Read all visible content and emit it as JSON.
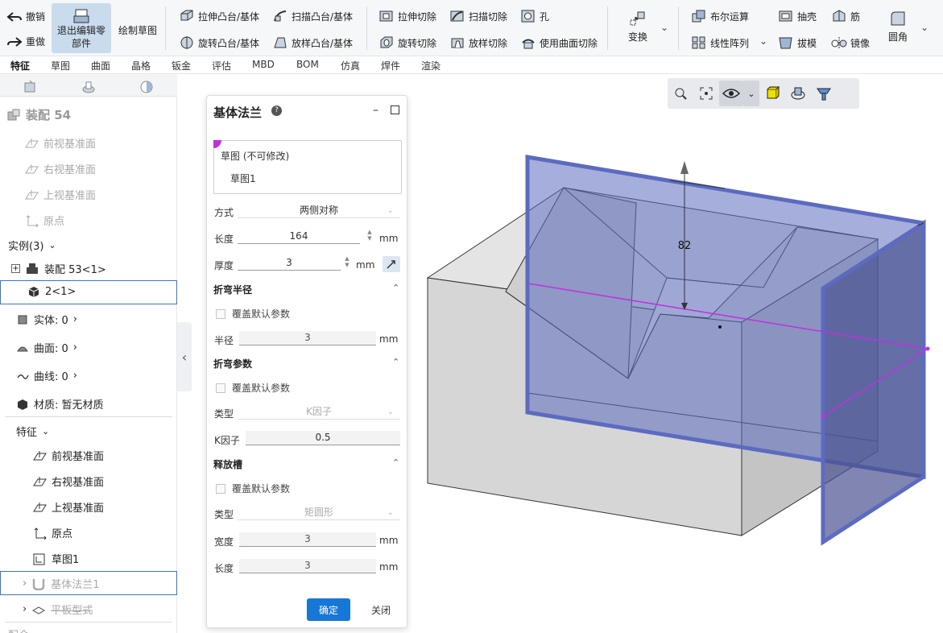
{
  "ribbon": {
    "undo": "撤销",
    "redo": "重做",
    "exit_edit": "退出编辑零部件",
    "exit_edit_l1": "退出编辑零",
    "exit_edit_l2": "部件",
    "sketch": "绘制草图",
    "extrude_boss": "拉伸凸台/基体",
    "sweep_boss": "扫描凸台/基体",
    "revolve_boss": "旋转凸台/基体",
    "loft_boss": "放样凸台/基体",
    "extrude_cut": "拉伸切除",
    "sweep_cut": "扫描切除",
    "hole": "孔",
    "revolve_cut": "旋转切除",
    "loft_cut": "放样切除",
    "surface_cut": "使用曲面切除",
    "transform": "变换",
    "boolean": "布尔运算",
    "linear_pattern": "线性阵列",
    "shell": "抽壳",
    "rib": "筋",
    "draft": "拔模",
    "mirror": "镜像",
    "fillet": "圆角"
  },
  "tabs": [
    "特征",
    "草图",
    "曲面",
    "晶格",
    "钣金",
    "评估",
    "MBD",
    "BOM",
    "仿真",
    "焊件",
    "渲染"
  ],
  "tree": {
    "assembly_title": "装配 54",
    "front_plane": "前视基准面",
    "right_plane": "右视基准面",
    "top_plane": "上视基准面",
    "origin": "原点",
    "instances": "实例(3)",
    "sub_assembly": "装配 53<1>",
    "part_instance": "2<1>",
    "solids": "实体: 0",
    "surfaces": "曲面: 0",
    "curves": "曲线: 0",
    "material": "材质: 暂无材质",
    "features": "特征",
    "sketch1": "草图1",
    "base_flange": "基体法兰1",
    "flat_pattern": "平板型式",
    "mates": "配合"
  },
  "panel": {
    "title": "基体法兰",
    "sketch_label": "草图 (不可修改)",
    "sketch_value": "草图1",
    "method_label": "方式",
    "method_value": "两侧对称",
    "length_label": "长度",
    "length_value": "164",
    "length_unit": "mm",
    "thickness_label": "厚度",
    "thickness_value": "3",
    "thickness_unit": "mm",
    "bend_radius_section": "折弯半径",
    "override_default": "覆盖默认参数",
    "radius_label": "半径",
    "radius_value": "3",
    "radius_unit": "mm",
    "bend_params_section": "折弯参数",
    "type_label": "类型",
    "bend_type_value": "K因子",
    "kfactor_label": "K因子",
    "kfactor_value": "0.5",
    "relief_section": "释放槽",
    "relief_type_value": "矩圆形",
    "width_label": "宽度",
    "width_value": "3",
    "width_unit": "mm",
    "relief_length_label": "长度",
    "relief_length_value": "3",
    "relief_length_unit": "mm",
    "ok": "确定",
    "close": "关闭"
  },
  "viewport": {
    "dimension_label": "82"
  },
  "colors": {
    "accent": "#1677d6",
    "selection": "#3b74c8",
    "flange_plane": "#5c6bc0",
    "sketch_line": "#c030e0"
  }
}
